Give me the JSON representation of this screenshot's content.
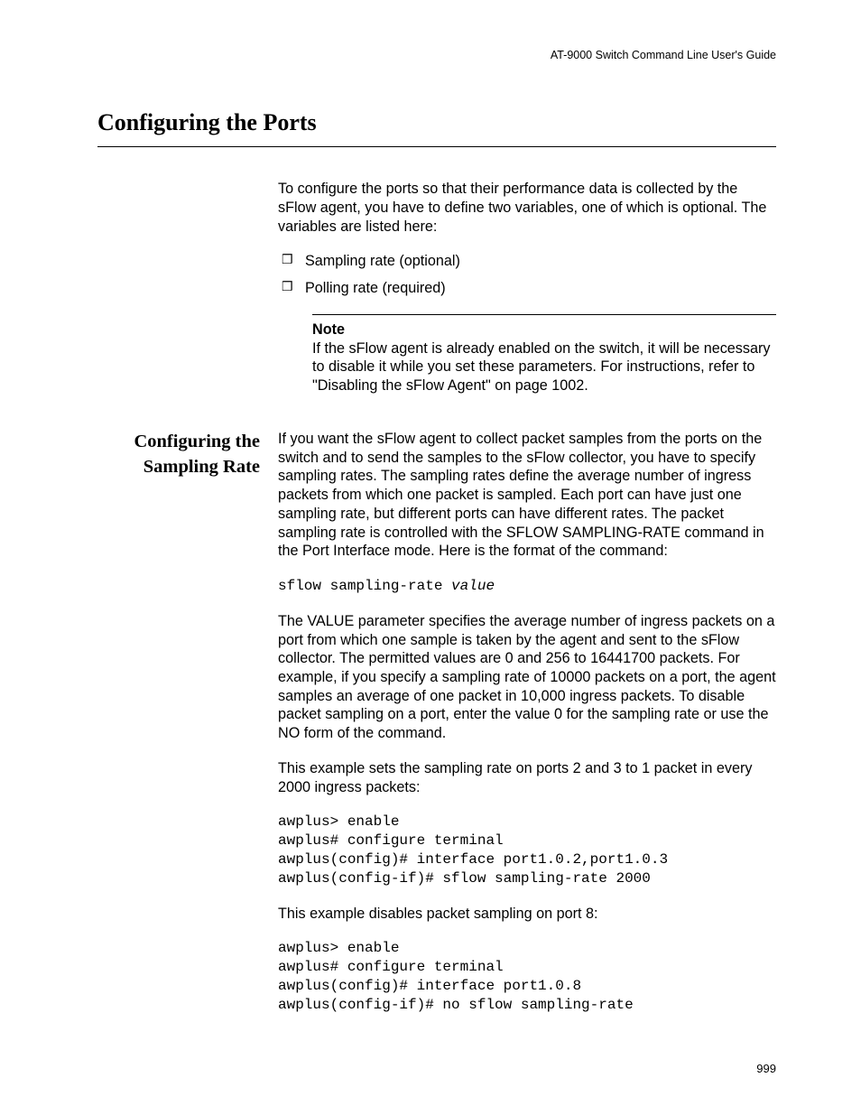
{
  "doc_header": "AT-9000 Switch Command Line User's Guide",
  "section_title": "Configuring the Ports",
  "intro": "To configure the ports so that their performance data is collected by the sFlow agent, you have to define two variables, one of which is optional. The variables are listed here:",
  "bullets": {
    "b0": "Sampling rate (optional)",
    "b1": "Polling rate (required)"
  },
  "note": {
    "label": "Note",
    "body": "If the sFlow agent is already enabled on the switch, it will be necessary to disable it while you set these parameters. For instructions, refer to \"Disabling the sFlow Agent\" on page 1002."
  },
  "subheading": "Configuring the Sampling Rate",
  "para1": "If you want the sFlow agent to collect packet samples from the ports on the switch and to send the samples to the sFlow collector, you have to specify sampling rates. The sampling rates define the average number of ingress packets from which one packet is sampled. Each port can have just one sampling rate, but different ports can have different rates. The packet sampling rate is controlled with the SFLOW SAMPLING-RATE command in the Port Interface mode. Here is the format of the command:",
  "cmd1_a": "sflow sampling-rate ",
  "cmd1_b": "value",
  "para2": "The VALUE parameter specifies the average number of ingress packets on a port from which one sample is taken by the agent and sent to the sFlow collector. The permitted values are 0 and 256 to 16441700 packets. For example, if you specify a sampling rate of 10000 packets on a port, the agent samples an average of one packet in 10,000 ingress packets. To disable packet sampling on a port, enter the value 0 for the sampling rate or use the NO form of the command.",
  "para3": "This example sets the sampling rate on ports 2 and 3 to 1 packet in every 2000 ingress packets:",
  "cmd2": "awplus> enable\nawplus# configure terminal\nawplus(config)# interface port1.0.2,port1.0.3\nawplus(config-if)# sflow sampling-rate 2000",
  "para4": "This example disables packet sampling on port 8:",
  "cmd3": "awplus> enable\nawplus# configure terminal\nawplus(config)# interface port1.0.8\nawplus(config-if)# no sflow sampling-rate",
  "page_number": "999"
}
